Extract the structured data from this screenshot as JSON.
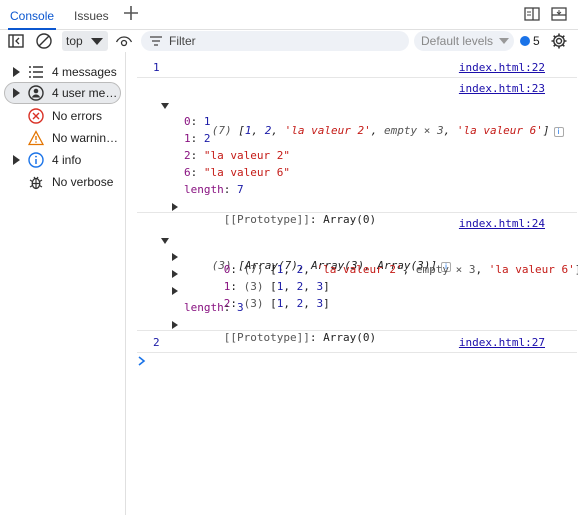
{
  "tabs": [
    {
      "label": "Console",
      "active": true
    },
    {
      "label": "Issues",
      "active": false
    }
  ],
  "toolbar": {
    "context": "top",
    "filter_placeholder": "Filter",
    "levels": "Default levels",
    "issues_count": "5"
  },
  "sidebar": {
    "items": [
      {
        "label": "4 messages",
        "icon": "list-icon",
        "has_arrow": true,
        "selected": false
      },
      {
        "label": "4 user me…",
        "icon": "user-icon",
        "has_arrow": true,
        "selected": true
      },
      {
        "label": "No errors",
        "icon": "error-icon",
        "has_arrow": false,
        "selected": false
      },
      {
        "label": "No warnin…",
        "icon": "warning-icon",
        "has_arrow": false,
        "selected": false
      },
      {
        "label": "4 info",
        "icon": "info-icon",
        "has_arrow": true,
        "selected": false
      },
      {
        "label": "No verbose",
        "icon": "bug-icon",
        "has_arrow": false,
        "selected": false
      }
    ]
  },
  "console": {
    "messages": [
      {
        "source": "index.html:22",
        "value": "1"
      },
      {
        "source": "index.html:23",
        "summary_count": "(7)",
        "summary_items": [
          "1",
          "2",
          "'la valeur 2'",
          "empty × 3",
          "'la valeur 6'"
        ],
        "entries": [
          {
            "key": "0",
            "value": "1",
            "kind": "num"
          },
          {
            "key": "1",
            "value": "2",
            "kind": "num"
          },
          {
            "key": "2",
            "value": "\"la valeur 2\"",
            "kind": "str"
          },
          {
            "key": "6",
            "value": "\"la valeur 6\"",
            "kind": "str"
          },
          {
            "key": "length",
            "value": "7",
            "kind": "num"
          }
        ],
        "prototype_key": "[[Prototype]]",
        "prototype_value": "Array(0)"
      },
      {
        "source": "index.html:24",
        "summary_count": "(3)",
        "summary_items": [
          "Array(7)",
          "Array(3)",
          "Array(3)"
        ],
        "entries": [
          {
            "key": "0",
            "count": "(7)",
            "items": [
              "1",
              "2",
              "'la valeur 2'",
              "empty × 3",
              "'la valeur 6'"
            ]
          },
          {
            "key": "1",
            "count": "(3)",
            "items": [
              "1",
              "2",
              "3"
            ]
          },
          {
            "key": "2",
            "count": "(3)",
            "items": [
              "1",
              "2",
              "3"
            ]
          }
        ],
        "length_key": "length",
        "length_value": "3",
        "prototype_key": "[[Prototype]]",
        "prototype_value": "Array(0)"
      },
      {
        "source": "index.html:27",
        "value": "2"
      }
    ]
  }
}
